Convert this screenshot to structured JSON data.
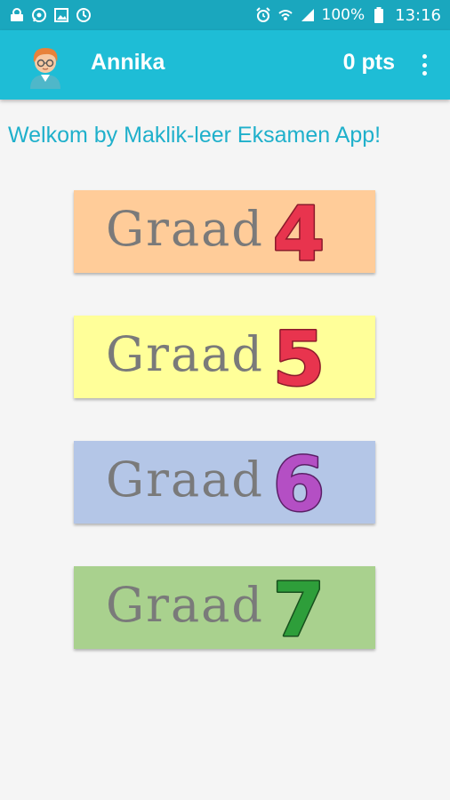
{
  "status_bar": {
    "battery_percent": "100%",
    "time": "13:16",
    "icons": [
      "settings-app-icon",
      "whatsapp-icon",
      "gallery-icon",
      "sync-icon",
      "alarm-icon",
      "wifi-calling-icon",
      "signal-icon",
      "battery-icon"
    ]
  },
  "app_bar": {
    "user_name": "Annika",
    "points": "0 pts",
    "avatar_icon": "teacher-avatar-icon",
    "menu_icon": "more-vert-icon",
    "color": "#1ebdd6"
  },
  "welcome_text": "Welkom by Maklik-leer Eksamen App!",
  "grades": [
    {
      "label": "Graad",
      "number": "4",
      "bg": "#ffcc99",
      "num_color": "#e8344e"
    },
    {
      "label": "Graad",
      "number": "5",
      "bg": "#ffff99",
      "num_color": "#e8344e"
    },
    {
      "label": "Graad",
      "number": "6",
      "bg": "#b4c6e7",
      "num_color": "#b44fc4"
    },
    {
      "label": "Graad",
      "number": "7",
      "bg": "#a9d18e",
      "num_color": "#2e9e3a"
    }
  ]
}
